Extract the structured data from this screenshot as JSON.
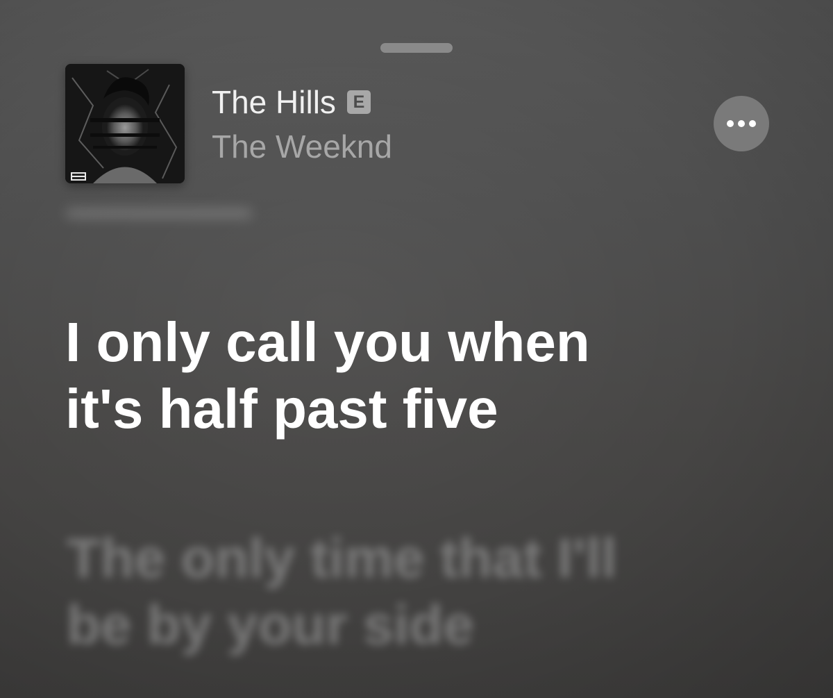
{
  "now_playing": {
    "title": "The Hills",
    "explicit_badge": "E",
    "artist": "The Weeknd",
    "artwork_icon": "album-cover-art",
    "more_icon": "ellipsis-icon"
  },
  "lyrics": {
    "current_line_1": "I only call you when",
    "current_line_2": "it's half past five",
    "next_line_1": "The only time that I'll",
    "next_line_2": "be by your side"
  },
  "colors": {
    "background": "#4e4e4e",
    "current_lyric": "#ffffff",
    "artist_text": "#a7a7a7",
    "more_button": "#7a7a7a"
  }
}
